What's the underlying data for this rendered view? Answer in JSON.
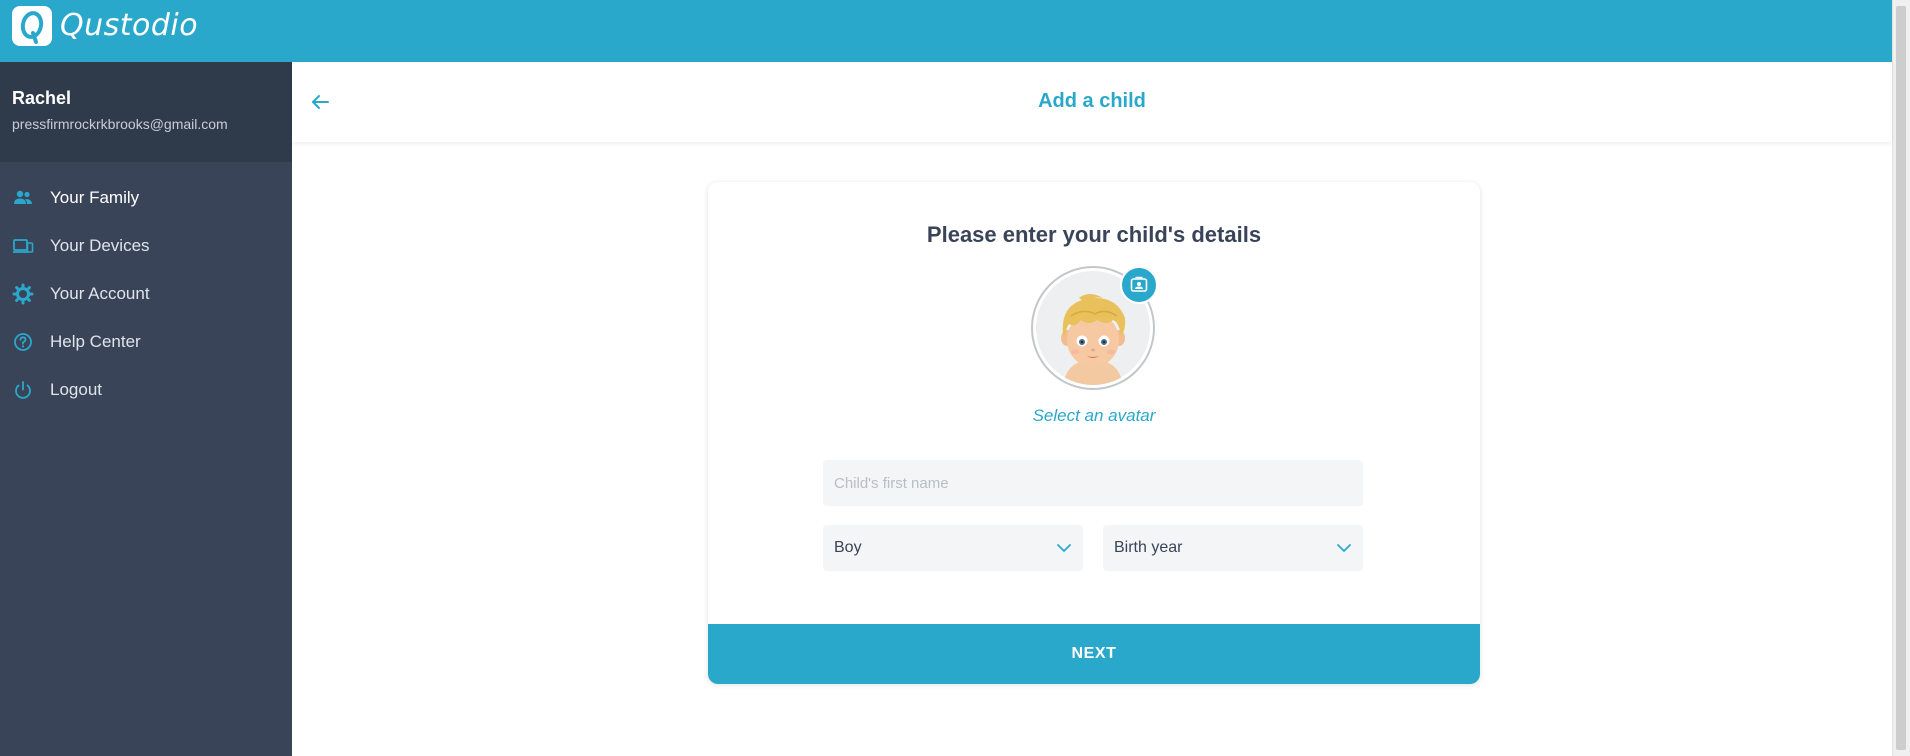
{
  "app": {
    "brand": "Qustodio",
    "logo_icon": "qustodio-logo-icon",
    "accent_color": "#2aa8cb",
    "sidebar_color": "#3a4458"
  },
  "user": {
    "name": "Rachel",
    "email": "pressfirmrockrkbrooks@gmail.com"
  },
  "sidebar": {
    "items": [
      {
        "label": "Your Family",
        "icon": "family-icon",
        "active": true
      },
      {
        "label": "Your Devices",
        "icon": "devices-icon",
        "active": false
      },
      {
        "label": "Your Account",
        "icon": "gear-icon",
        "active": false
      },
      {
        "label": "Help Center",
        "icon": "help-icon",
        "active": false
      },
      {
        "label": "Logout",
        "icon": "power-icon",
        "active": false
      }
    ]
  },
  "header": {
    "title": "Add a child",
    "back_icon": "arrow-left-icon"
  },
  "form": {
    "heading": "Please enter your child's details",
    "select_avatar_label": "Select an avatar",
    "name_placeholder": "Child's first name",
    "name_value": "",
    "gender": {
      "selected": "Boy"
    },
    "birth_year": {
      "selected": "Birth year"
    },
    "next_label": "NEXT"
  }
}
